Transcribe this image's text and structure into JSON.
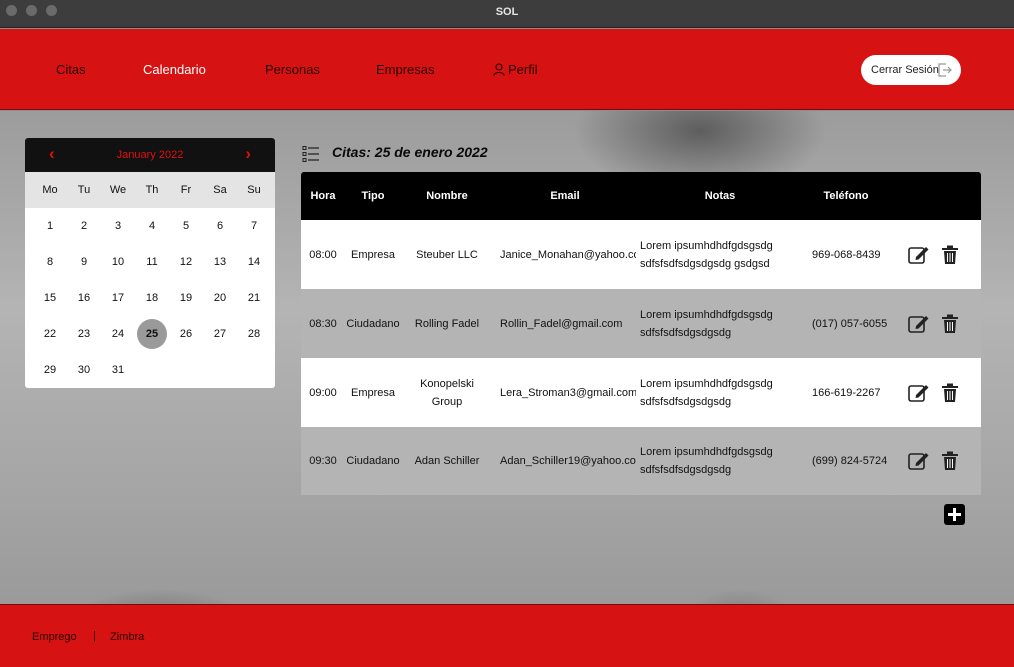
{
  "window": {
    "title": "SOL"
  },
  "nav": {
    "items": [
      "Citas",
      "Calendario",
      "Personas",
      "Empresas",
      "Perfil"
    ],
    "active": "Calendario",
    "logout_label": "Cerrar Sesión"
  },
  "calendar": {
    "month_label": "January 2022",
    "prev": "‹",
    "next": "›",
    "weekdays": [
      "Mo",
      "Tu",
      "We",
      "Th",
      "Fr",
      "Sa",
      "Su"
    ],
    "days": [
      "1",
      "2",
      "3",
      "4",
      "5",
      "6",
      "7",
      "8",
      "9",
      "10",
      "11",
      "12",
      "13",
      "14",
      "15",
      "16",
      "17",
      "18",
      "19",
      "20",
      "21",
      "22",
      "23",
      "24",
      "25",
      "26",
      "27",
      "28",
      "29",
      "30",
      "31"
    ],
    "selected": "25"
  },
  "appointments": {
    "title": "Citas: 25 de enero 2022",
    "headers": [
      "Hora",
      "Tipo",
      "Nombre",
      "Email",
      "Notas",
      "Teléfono"
    ],
    "rows": [
      {
        "hora": "08:00",
        "tipo": "Empresa",
        "nombre": "Steuber LLC",
        "email": "Janice_Monahan@yahoo.com",
        "notas": "Lorem ipsumhdhdfgdsgsdg sdfsfsdfsdgsdgsdg gsdgsd",
        "telefono": "969-068-8439"
      },
      {
        "hora": "08:30",
        "tipo": "Ciudadano",
        "nombre": "Rolling Fadel",
        "email": "Rollin_Fadel@gmail.com",
        "notas": "Lorem ipsumhdhdfgdsgsdg sdfsfsdfsdgsdgsdg",
        "telefono": "(017) 057-6055"
      },
      {
        "hora": "09:00",
        "tipo": "Empresa",
        "nombre": "Konopelski Group",
        "email": "Lera_Stroman3@gmail.com",
        "notas": "Lorem ipsumhdhdfgdsgsdg sdfsfsdfsdgsdgsdg",
        "telefono": "166-619-2267"
      },
      {
        "hora": "09:30",
        "tipo": "Ciudadano",
        "nombre": "Adan Schiller",
        "email": "Adan_Schiller19@yahoo.com",
        "notas": "Lorem ipsumhdhdfgdsgsdg sdfsfsdfsdgsdgsdg",
        "telefono": "(699) 824-5724"
      }
    ],
    "row_actions": [
      "edit-icon",
      "trash-icon"
    ],
    "add_action": "plus-icon"
  },
  "footer": {
    "links": [
      "Emprego",
      "Zimbra"
    ],
    "separator": "|"
  },
  "colors": {
    "brand_red": "#d71212",
    "header_black": "#000000",
    "calendar_accent": "#e01010"
  }
}
